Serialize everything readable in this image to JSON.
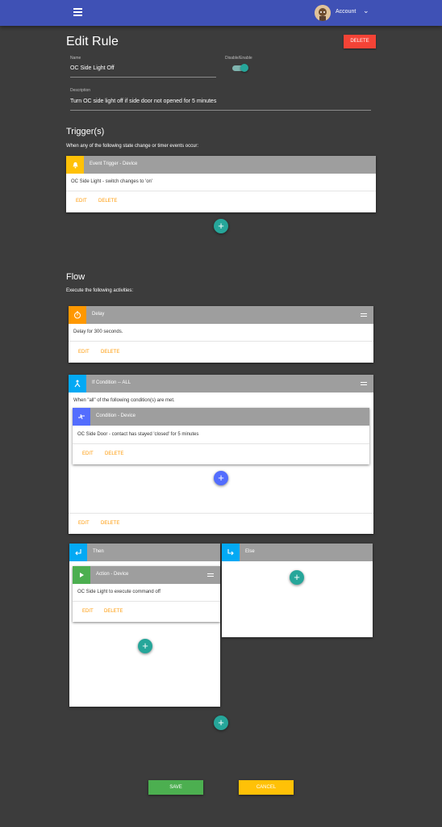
{
  "header": {
    "account_label": "Account",
    "colors": {
      "bar": "#3f51b5"
    }
  },
  "page": {
    "title": "Edit Rule",
    "delete_label": "DELETE",
    "name_label": "Name",
    "name_value": "OC Side Light Off",
    "toggle_label": "Disable/Enable",
    "toggle_state": "enabled",
    "description_label": "Description",
    "description_value": "Turn OC side light off if side door not opened for 5 minutes"
  },
  "triggers": {
    "heading": "Trigger(s)",
    "subtext": "When any of the following state change or timer events occur:",
    "card": {
      "title": "Event Trigger - Device",
      "body": "OC Side Light - switch changes to 'on'",
      "edit": "EDIT",
      "delete": "DELETE",
      "icon": "bell-icon",
      "accent": "#ffc107"
    }
  },
  "flow": {
    "heading": "Flow",
    "subtext": "Execute the following activities:",
    "delay": {
      "title": "Delay",
      "body": "Delay for 300 seconds.",
      "edit": "EDIT",
      "delete": "DELETE",
      "icon": "timer-icon",
      "accent": "#ff9800"
    },
    "if_condition": {
      "title": "If Condition -- ALL",
      "body": "When \"all\" of the following condition(s) are met.",
      "edit": "EDIT",
      "delete": "DELETE",
      "icon": "merge-icon",
      "accent": "#03a9f4",
      "condition": {
        "title": "Condition - Device",
        "body": "OC Side Door - contact has stayed 'closed' for 5 minutes",
        "edit": "EDIT",
        "delete": "DELETE",
        "icon": "compare-icon",
        "accent": "#536dfe"
      }
    },
    "then": {
      "title": "Then",
      "icon": "return-icon",
      "accent": "#03a9f4",
      "action": {
        "title": "Action - Device",
        "body": "OC Side Light to execute command off",
        "edit": "EDIT",
        "delete": "DELETE",
        "icon": "play-icon",
        "accent": "#4caf50"
      }
    },
    "else": {
      "title": "Else",
      "icon": "subdirectory-icon",
      "accent": "#03a9f4"
    }
  },
  "footer": {
    "save_label": "SAVE",
    "cancel_label": "CANCEL",
    "save_color": "#4caf50",
    "cancel_color": "#ffc107"
  }
}
